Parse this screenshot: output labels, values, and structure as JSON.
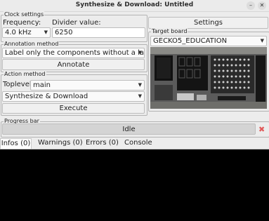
{
  "window": {
    "title": "Synthesize & Download: Untitled"
  },
  "clock": {
    "legend": "Clock settings",
    "frequency_label": "Frequency:",
    "divider_label": "Divider value:",
    "frequency_value": "4.0 kHz",
    "divider_value": "6250"
  },
  "settings_button": "Settings",
  "annotation": {
    "legend": "Annotation method",
    "method": "Label only the components without a label",
    "annotate_button": "Annotate"
  },
  "target": {
    "legend": "Target board",
    "board": "GECKO5_EDUCATION"
  },
  "action": {
    "legend": "Action method",
    "toplevel_label": "Toplevel:",
    "toplevel_value": "main",
    "action_value": "Synthesize & Download",
    "execute_button": "Execute"
  },
  "progress": {
    "legend": "Progress bar",
    "status": "Idle"
  },
  "tabs": [
    "Infos (0)",
    "Warnings (0)",
    "Errors (0)",
    "Console"
  ]
}
